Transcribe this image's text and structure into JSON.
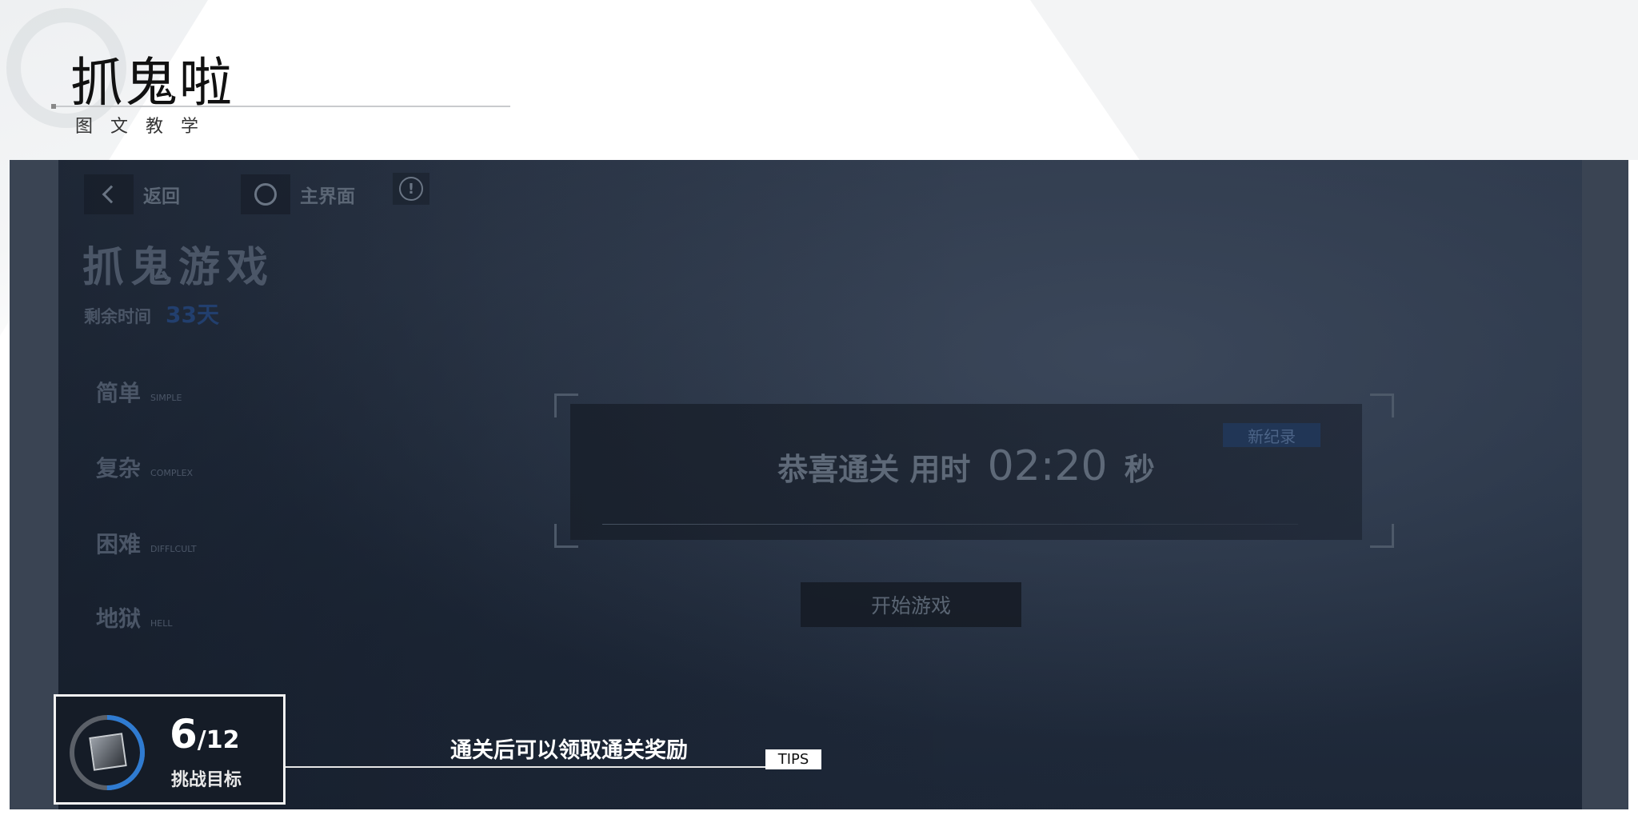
{
  "header": {
    "title": "抓鬼啦",
    "subtitle": "图文教学"
  },
  "game": {
    "nav": {
      "back_label": "返回",
      "home_label": "主界面"
    },
    "title": "抓鬼游戏",
    "remaining_label": "剩余时间",
    "remaining_value": "33天",
    "difficulties": [
      {
        "cn": "简单",
        "en": "SIMPLE"
      },
      {
        "cn": "复杂",
        "en": "COMPLEX"
      },
      {
        "cn": "困难",
        "en": "DIFFLCULT"
      },
      {
        "cn": "地狱",
        "en": "HELL"
      }
    ],
    "result": {
      "prefix": "恭喜通关 用时",
      "time": "02:20",
      "suffix": "秒",
      "badge": "新纪录"
    },
    "start_label": "开始游戏"
  },
  "challenge": {
    "current": "6",
    "total": "/12",
    "label": "挑战目标",
    "progress": 0.5
  },
  "tip": {
    "text": "通关后可以领取通关奖励",
    "tag": "TIPS"
  },
  "colors": {
    "panel_bg": "#3a4453",
    "progress_accent": "#2f7bd1",
    "record_badge": "#213656"
  }
}
